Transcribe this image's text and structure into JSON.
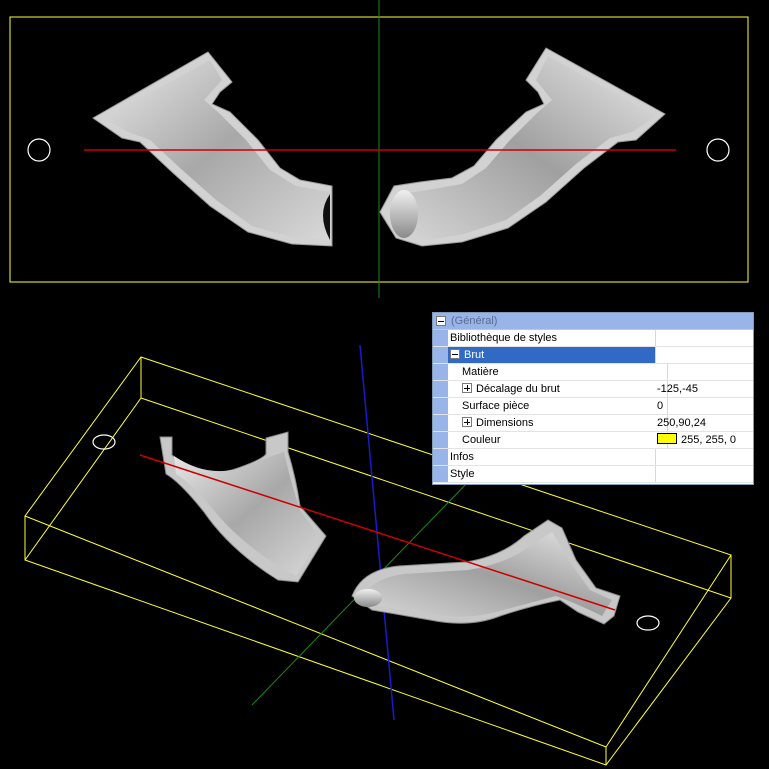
{
  "viewport": {
    "background": "#000000",
    "bounding_box_color": "#ffff33",
    "axis_x_color": "#cc0000",
    "axis_y_color": "#1a8a1a",
    "axis_z_color": "#1a1acc",
    "part_color": "#c0c0c0"
  },
  "properties": {
    "category": "(Général)",
    "rows": [
      {
        "name": "Bibliothèque de styles",
        "value": "",
        "indent": 1,
        "toggle": "",
        "selected": false
      },
      {
        "name": "Brut",
        "value": "",
        "indent": 1,
        "toggle": "minus",
        "selected": true
      },
      {
        "name": "Matière",
        "value": "",
        "indent": 2,
        "toggle": "",
        "selected": false
      },
      {
        "name": "Décalage du brut",
        "value": "-125,-45",
        "indent": 2,
        "toggle": "plus",
        "selected": false
      },
      {
        "name": "Surface pièce",
        "value": "0",
        "indent": 2,
        "toggle": "",
        "selected": false
      },
      {
        "name": "Dimensions",
        "value": "250,90,24",
        "indent": 2,
        "toggle": "plus",
        "selected": false
      },
      {
        "name": "Couleur",
        "value": "255, 255, 0",
        "indent": 2,
        "toggle": "",
        "selected": false,
        "swatch": "#ffff00"
      },
      {
        "name": "Infos",
        "value": "",
        "indent": 1,
        "toggle": "",
        "selected": false
      },
      {
        "name": "Style",
        "value": "",
        "indent": 1,
        "toggle": "",
        "selected": false
      }
    ]
  }
}
